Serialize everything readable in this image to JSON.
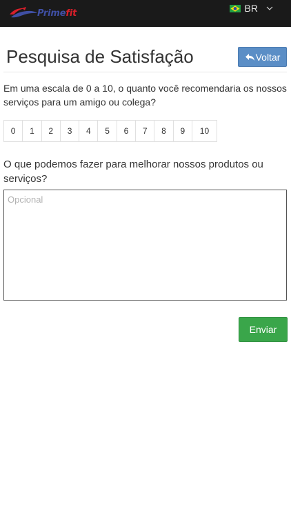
{
  "header": {
    "logo": {
      "prime": "Prime",
      "fit": "fit"
    },
    "language": {
      "label": "BR",
      "flag_icon": "brazil-flag-icon"
    },
    "colors": {
      "bar": "#1a1a1a",
      "prime": "#3f4fa3",
      "fit": "#d81f2a"
    }
  },
  "page": {
    "title": "Pesquisa de Satisfação",
    "back_label": "Voltar"
  },
  "survey": {
    "question_nps": "Em uma escala de 0 a 10, o quanto você recomendaria os nossos serviços para um amigo ou colega?",
    "scale": [
      "0",
      "1",
      "2",
      "3",
      "4",
      "5",
      "6",
      "7",
      "8",
      "9",
      "10"
    ],
    "question_improve": "O que podemos fazer para melhorar nossos produtos ou serviços?",
    "improve_placeholder": "Opcional",
    "submit_label": "Enviar"
  },
  "colors": {
    "back_button": "#5b8ec6",
    "submit_button": "#3aa64a"
  }
}
